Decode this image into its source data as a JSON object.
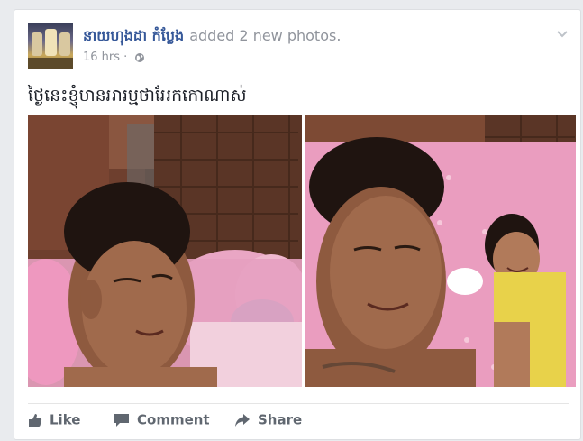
{
  "post": {
    "author": "នាយហុងដា កំប្លែង",
    "action": "added 2 new photos.",
    "time": "16 hrs",
    "separator": "·",
    "privacy_icon": "globe-icon",
    "menu_icon": "chevron-down-icon",
    "text": "ថ្ងៃនេះខ្ញុំមានអារម្មថាអែកកោណាស់"
  },
  "photos": [
    {
      "description_icon": "photo-1"
    },
    {
      "description_icon": "photo-2"
    }
  ],
  "actions": {
    "like": "Like",
    "comment": "Comment",
    "share": "Share"
  },
  "colors": {
    "link": "#365899",
    "meta": "#90949c",
    "action": "#606770",
    "background": "#e9ebee"
  }
}
